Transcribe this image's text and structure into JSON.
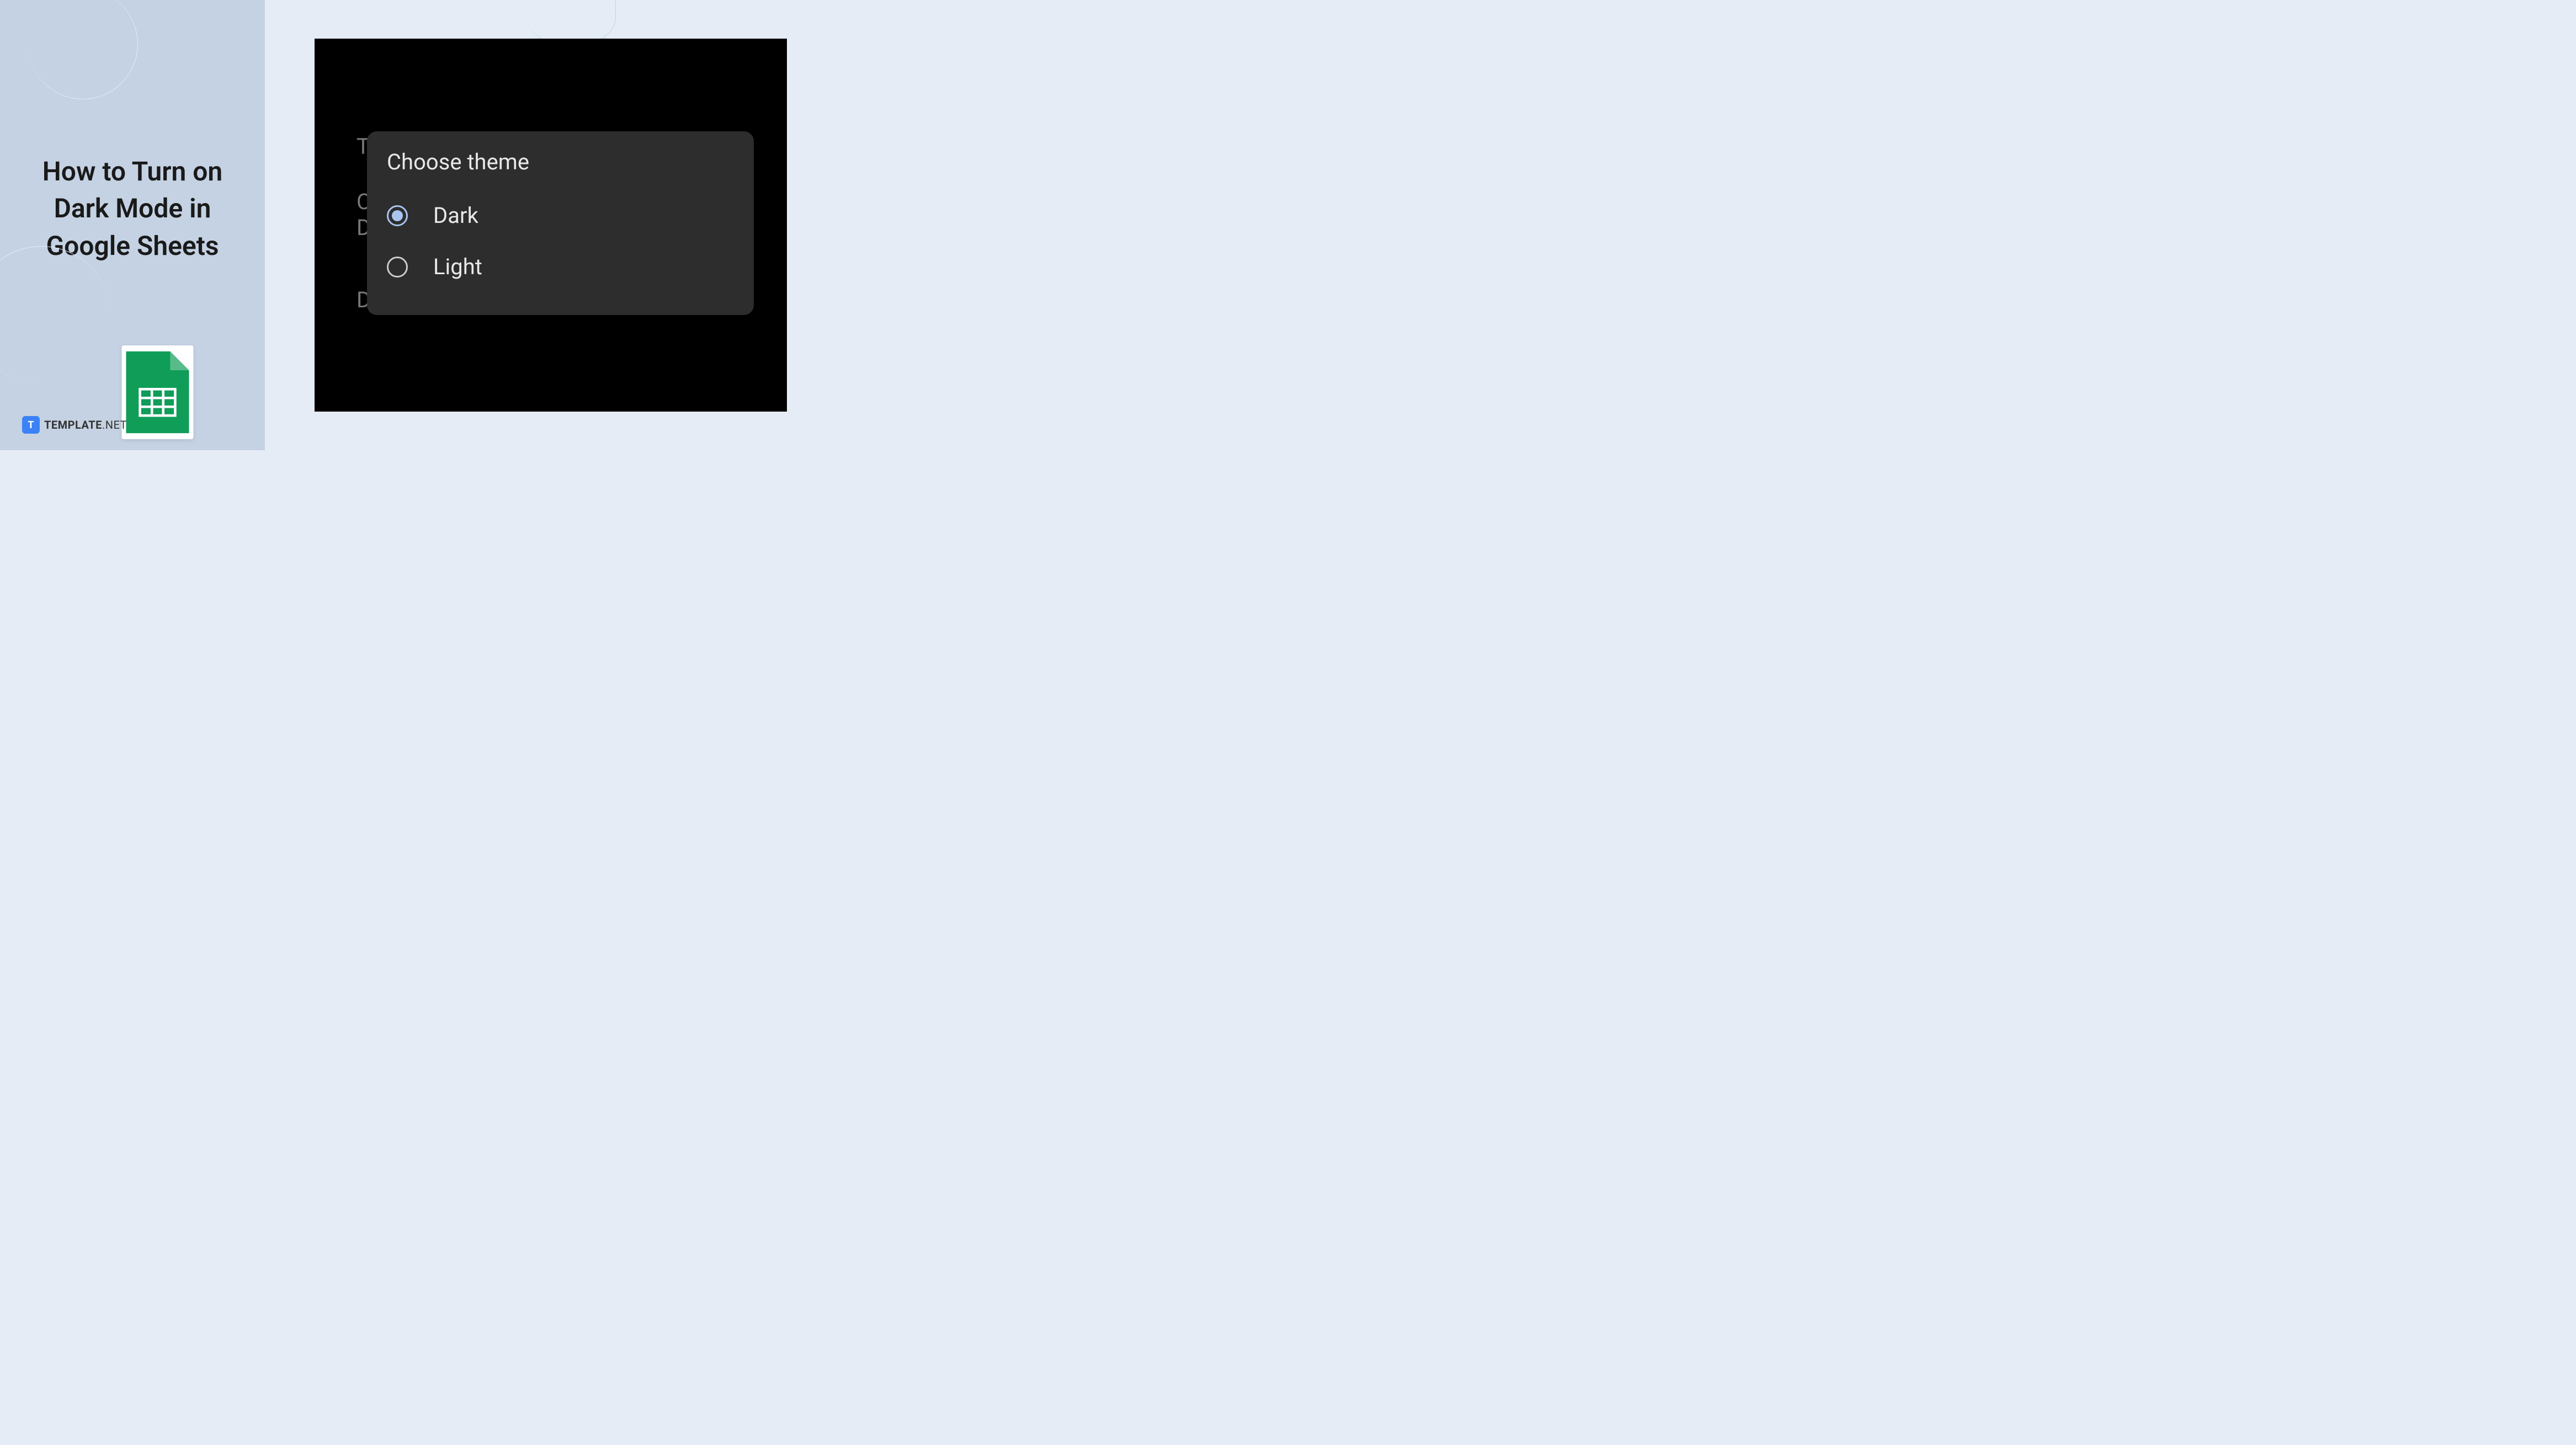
{
  "title": "How to Turn on Dark Mode in Google Sheets",
  "logo": {
    "icon_letter": "T",
    "text_main": "TEMPLATE",
    "text_suffix": ".NET"
  },
  "background_text": {
    "line1": "T",
    "line2": "C",
    "line3": "D",
    "line4": "D"
  },
  "dialog": {
    "title": "Choose theme",
    "options": [
      {
        "label": "Dark",
        "selected": true
      },
      {
        "label": "Light",
        "selected": false
      }
    ]
  }
}
